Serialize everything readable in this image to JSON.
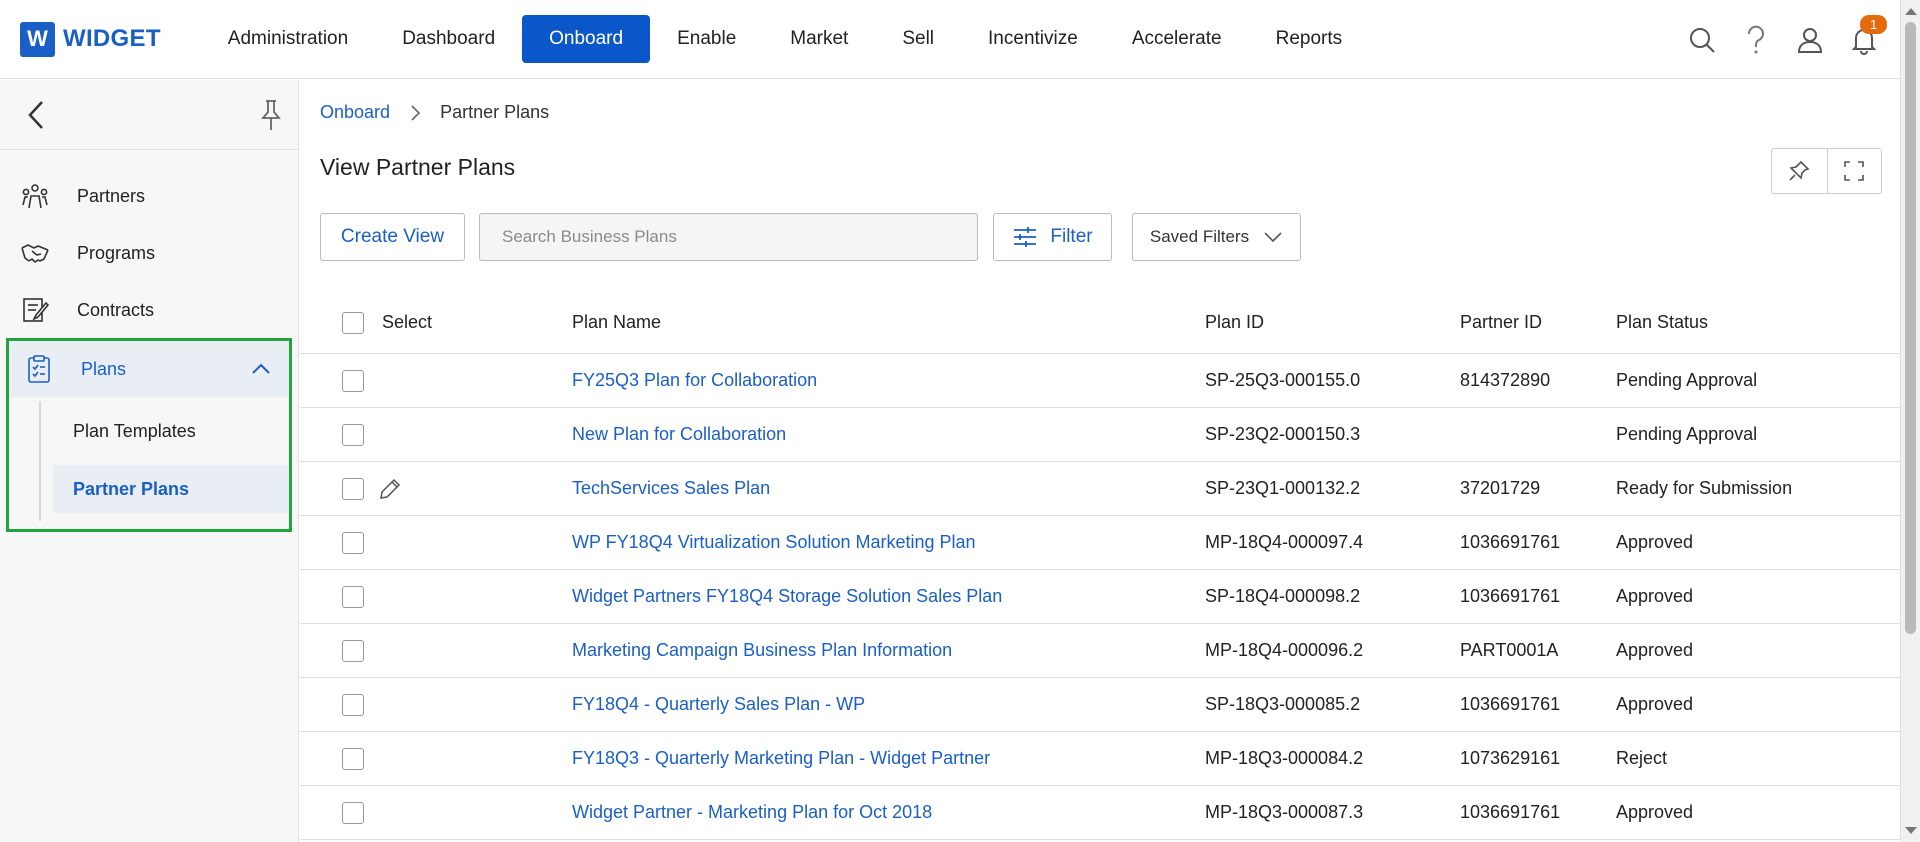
{
  "app": {
    "logo_letter": "W",
    "logo_text": "WIDGET",
    "brand_color": "#1a5fc6"
  },
  "nav": {
    "items": [
      {
        "label": "Administration"
      },
      {
        "label": "Dashboard"
      },
      {
        "label": "Onboard",
        "active": true
      },
      {
        "label": "Enable"
      },
      {
        "label": "Market"
      },
      {
        "label": "Sell"
      },
      {
        "label": "Incentivize"
      },
      {
        "label": "Accelerate"
      },
      {
        "label": "Reports"
      }
    ],
    "icons": [
      "search-icon",
      "help-icon",
      "user-icon",
      "bell-icon"
    ],
    "notification_count": "1"
  },
  "sidebar": {
    "items": [
      {
        "label": "Partners",
        "icon": "partners-icon"
      },
      {
        "label": "Programs",
        "icon": "handshake-icon"
      },
      {
        "label": "Contracts",
        "icon": "contract-icon"
      }
    ],
    "plans": {
      "label": "Plans",
      "icon": "clipboard-icon",
      "expanded": true,
      "children": [
        {
          "label": "Plan Templates"
        },
        {
          "label": "Partner Plans",
          "active": true
        }
      ]
    }
  },
  "breadcrumb": {
    "parent": "Onboard",
    "current": "Partner Plans"
  },
  "page": {
    "title": "View Partner Plans"
  },
  "toolbar": {
    "create_view_label": "Create View",
    "search_placeholder": "Search Business Plans",
    "filter_label": "Filter",
    "saved_filters_label": "Saved Filters"
  },
  "table": {
    "headers": {
      "select": "Select",
      "name": "Plan Name",
      "id": "Plan ID",
      "partner": "Partner ID",
      "status": "Plan Status"
    },
    "rows": [
      {
        "name": "FY25Q3 Plan for Collaboration",
        "id": "SP-25Q3-000155.0",
        "partner": "814372890",
        "status": "Pending Approval",
        "editable": false
      },
      {
        "name": "New Plan for Collaboration",
        "id": "SP-23Q2-000150.3",
        "partner": "",
        "status": "Pending Approval",
        "editable": false
      },
      {
        "name": "TechServices Sales Plan",
        "id": "SP-23Q1-000132.2",
        "partner": "37201729",
        "status": "Ready for Submission",
        "editable": true
      },
      {
        "name": "WP FY18Q4 Virtualization Solution Marketing Plan",
        "id": "MP-18Q4-000097.4",
        "partner": "1036691761",
        "status": "Approved",
        "editable": false
      },
      {
        "name": "Widget Partners FY18Q4 Storage Solution Sales Plan",
        "id": "SP-18Q4-000098.2",
        "partner": "1036691761",
        "status": "Approved",
        "editable": false
      },
      {
        "name": "Marketing Campaign Business Plan Information",
        "id": "MP-18Q4-000096.2",
        "partner": "PART0001A",
        "status": "Approved",
        "editable": false
      },
      {
        "name": "FY18Q4 - Quarterly Sales Plan - WP",
        "id": "SP-18Q3-000085.2",
        "partner": "1036691761",
        "status": "Approved",
        "editable": false
      },
      {
        "name": "FY18Q3 - Quarterly Marketing Plan - Widget Partner",
        "id": "MP-18Q3-000084.2",
        "partner": "1073629161",
        "status": "Reject",
        "editable": false
      },
      {
        "name": "Widget Partner - Marketing Plan for Oct 2018",
        "id": "MP-18Q3-000087.3",
        "partner": "1036691761",
        "status": "Approved",
        "editable": false
      }
    ]
  }
}
